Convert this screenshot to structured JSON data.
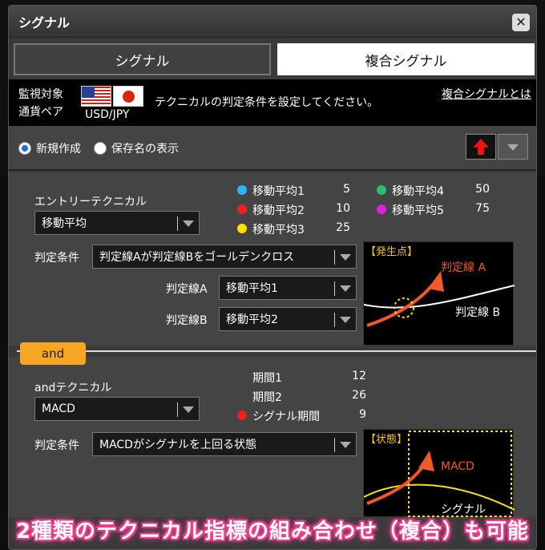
{
  "window": {
    "title": "シグナル",
    "close_label": "✕"
  },
  "tabs": [
    {
      "label": "シグナル",
      "active": false
    },
    {
      "label": "複合シグナル",
      "active": true
    }
  ],
  "target": {
    "label_line1": "監視対象",
    "label_line2": "通貨ペア",
    "pair": "USD/JPY",
    "description": "テクニカルの判定条件を設定してください。",
    "help_link": "複合シグナルとは"
  },
  "mode": {
    "new_label": "新規作成",
    "saved_label": "保存名の表示",
    "selected": "new"
  },
  "entry": {
    "heading": "エントリーテクニカル",
    "technical": "移動平均",
    "condition_label": "判定条件",
    "condition_value": "判定線Aが判定線Bをゴールデンクロス",
    "lineA_label": "判定線A",
    "lineA_value": "移動平均1",
    "lineB_label": "判定線B",
    "lineB_value": "移動平均2",
    "params": [
      {
        "name": "移動平均1",
        "value": "5",
        "color": "#29b6f6"
      },
      {
        "name": "移動平均2",
        "value": "10",
        "color": "#f02020"
      },
      {
        "name": "移動平均3",
        "value": "25",
        "color": "#ffe000"
      },
      {
        "name": "移動平均4",
        "value": "50",
        "color": "#2ebd6b"
      },
      {
        "name": "移動平均5",
        "value": "75",
        "color": "#e020e0"
      }
    ],
    "diagram": {
      "tag": "【発生点】",
      "lineA": "判定線 A",
      "lineB": "判定線 B"
    }
  },
  "and_section": {
    "badge": "and",
    "heading": "andテクニカル",
    "technical": "MACD",
    "condition_label": "判定条件",
    "condition_value": "MACDがシグナルを上回る状態",
    "params": [
      {
        "name": "期間1",
        "value": "12"
      },
      {
        "name": "期間2",
        "value": "26"
      },
      {
        "name": "シグナル期間",
        "value": "9",
        "color": "#f02020"
      }
    ],
    "diagram": {
      "tag": "【状態】",
      "macd": "MACD",
      "signal": "シグナル"
    }
  },
  "banner": "2種類のテクニカル指標の組み合わせ（複合）も可能",
  "colors": {
    "accent_orange": "#f05a28",
    "badge": "#f6a623",
    "radio_blue": "#1a6ee0",
    "banner_pink": "#e0307f"
  }
}
